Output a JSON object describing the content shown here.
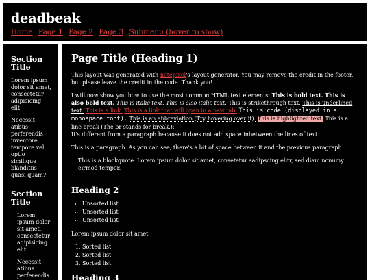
{
  "header": {
    "site_title": "deadbeak",
    "nav": [
      "Home",
      "Page 1",
      "Page 2",
      "Page 3",
      "Submenu (hover to show)"
    ]
  },
  "sidebar": {
    "blocks": [
      {
        "title": "Section Title",
        "paragraphs": [
          "Lorem ipsum dolor sit amet, consectetur adipisicing elit.",
          "Necessit atibus perferendis inventore tempore vel optio similique blanditiis quasi quam?"
        ]
      },
      {
        "title": "Section Title",
        "paragraphs": [
          "Lorem ipsum dolor sit amet, consectetur adipisicing elit.",
          "Necessit atibus perferendis inventore tempore vel"
        ]
      }
    ]
  },
  "main": {
    "page_title": "Page Title (Heading 1)",
    "intro": {
      "before": "This layout was generated with ",
      "link": "notepixel",
      "after": "'s layout generator. You may remove the credit in the footer, but please leave the credit in the code. Thank you!"
    },
    "elements": {
      "intro": "I will now show you how to use the most common HTML text elements: ",
      "bold1": "This is bold text.",
      "bold2": "This is also bold text.",
      "italic1": "This is italic text.",
      "italic2": "This is also italic text.",
      "strike": "This is strikethrough text.",
      "underline": "This is underlined text.",
      "link1": "This is a link.",
      "link2": "This is a link that will open in a new tab.",
      "code": "This is code (displayed in a monospace font).",
      "abbr": "This is an abbreviation (Try hovering over it).",
      "highlight": "This is highlighted text.",
      "line_break": "This is a line break (The br stands for break.):",
      "after_break": "It's different from a paragraph because it does not add space inbetween the lines of text."
    },
    "paragraph": "This is a paragraph. As you can see, there's a bit of space between it and the previous paragraph.",
    "blockquote": "This is a blockquote. Lorem ipsum dolor sit amet, consetetur sadipscing elitr, sed diam nonumy eirmod tempor.",
    "heading2": "Heading 2",
    "unordered": [
      "Unsorted list",
      "Unsorted list",
      "Unsorted list"
    ],
    "lorem": "Lorem ipsum dolor sit amet.",
    "ordered": [
      "Sorted list",
      "Sorted list",
      "Sorted list"
    ],
    "heading3": "Heading 3"
  },
  "colors": {
    "background": "#000000",
    "page": "#ffffff",
    "link": "#e0413f",
    "highlight": "#f0a8a6"
  }
}
